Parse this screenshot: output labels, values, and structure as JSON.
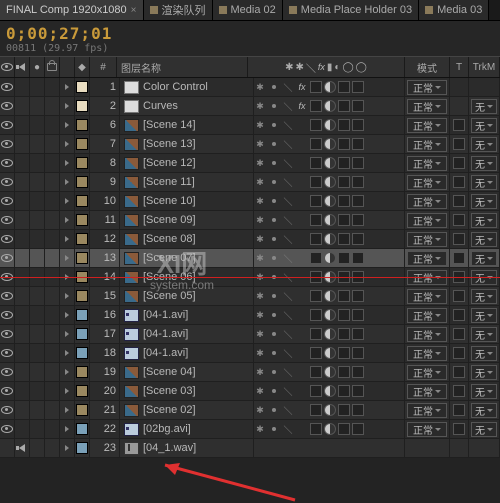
{
  "tabs": [
    {
      "label": "FINAL Comp 1920x1080",
      "active": true,
      "close": "×"
    },
    {
      "label": "渲染队列"
    },
    {
      "label": "Media 02"
    },
    {
      "label": "Media Place Holder 03"
    },
    {
      "label": "Media 03"
    }
  ],
  "timecode": {
    "main": "0;00;27;01",
    "sub": "00811 (29.97 fps)"
  },
  "columns": {
    "hash": "#",
    "layer_name": "图层名称",
    "mode": "模式",
    "t": "T",
    "trk": "TrkM"
  },
  "mode_label": "正常",
  "trk_label": "无",
  "layers": [
    {
      "num": 1,
      "name": "Color Control",
      "color": "#e8dcc0",
      "icon": "solid",
      "fx": true,
      "eye": true
    },
    {
      "num": 2,
      "name": "Curves",
      "color": "#e8dcc0",
      "icon": "solid",
      "fx": true,
      "eye": true
    },
    {
      "num": 6,
      "name": "[Scene 14]",
      "color": "#9a8860",
      "icon": "comp",
      "eye": true
    },
    {
      "num": 7,
      "name": "[Scene 13]",
      "color": "#9a8860",
      "icon": "comp",
      "eye": true
    },
    {
      "num": 8,
      "name": "[Scene 12]",
      "color": "#9a8860",
      "icon": "comp",
      "eye": true
    },
    {
      "num": 9,
      "name": "[Scene 11]",
      "color": "#9a8860",
      "icon": "comp",
      "eye": true
    },
    {
      "num": 10,
      "name": "[Scene 10]",
      "color": "#9a8860",
      "icon": "comp",
      "eye": true
    },
    {
      "num": 11,
      "name": "[Scene 09]",
      "color": "#9a8860",
      "icon": "comp",
      "eye": true
    },
    {
      "num": 12,
      "name": "[Scene 08]",
      "color": "#9a8860",
      "icon": "comp",
      "eye": true
    },
    {
      "num": 13,
      "name": "[Scene 07]",
      "color": "#9a8860",
      "icon": "comp",
      "eye": true,
      "sel": true
    },
    {
      "num": 14,
      "name": "[Scene 06]",
      "color": "#9a8860",
      "icon": "comp",
      "eye": true
    },
    {
      "num": 15,
      "name": "[Scene 05]",
      "color": "#9a8860",
      "icon": "comp",
      "eye": true
    },
    {
      "num": 16,
      "name": "[04-1.avi]",
      "color": "#7aa0b8",
      "icon": "img",
      "eye": true
    },
    {
      "num": 17,
      "name": "[04-1.avi]",
      "color": "#7aa0b8",
      "icon": "img",
      "eye": true
    },
    {
      "num": 18,
      "name": "[04-1.avi]",
      "color": "#7aa0b8",
      "icon": "img",
      "eye": true
    },
    {
      "num": 19,
      "name": "[Scene 04]",
      "color": "#9a8860",
      "icon": "comp",
      "eye": true
    },
    {
      "num": 20,
      "name": "[Scene 03]",
      "color": "#9a8860",
      "icon": "comp",
      "eye": true
    },
    {
      "num": 21,
      "name": "[Scene 02]",
      "color": "#9a8860",
      "icon": "comp",
      "eye": true
    },
    {
      "num": 22,
      "name": "[02bg.avi]",
      "color": "#7aa0b8",
      "icon": "img",
      "eye": true
    },
    {
      "num": 23,
      "name": "[04_1.wav]",
      "color": "#7aa0b8",
      "icon": "audio",
      "spk": true
    }
  ],
  "watermark": {
    "big": "XI网",
    "small": "system.com"
  }
}
